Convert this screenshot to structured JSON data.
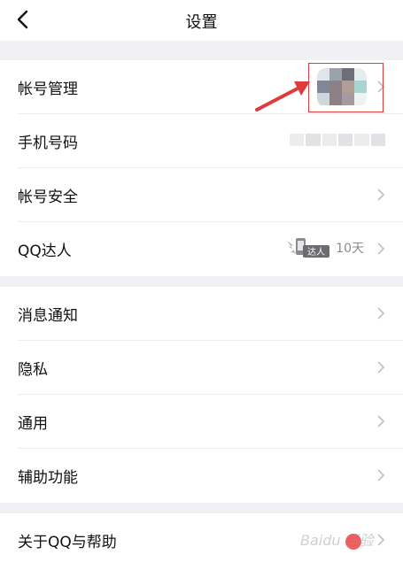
{
  "header": {
    "title": "设置",
    "back_icon": "chevron-left-icon"
  },
  "group1": {
    "account": {
      "label": "帐号管理"
    },
    "phone": {
      "label": "手机号码"
    },
    "security": {
      "label": "帐号安全"
    },
    "qq_expert": {
      "label": "QQ达人",
      "badge_text": "达人",
      "days": "10天"
    }
  },
  "group2": {
    "notifications": {
      "label": "消息通知"
    },
    "privacy": {
      "label": "隐私"
    },
    "general": {
      "label": "通用"
    },
    "accessibility": {
      "label": "辅助功能"
    }
  },
  "group3": {
    "about": {
      "label": "关于QQ与帮助"
    }
  },
  "watermark": {
    "text": "Baidu 经验"
  },
  "colors": {
    "highlight": "#e03a3a",
    "background": "#f1f1f5",
    "chevron": "#c4c4c8"
  }
}
